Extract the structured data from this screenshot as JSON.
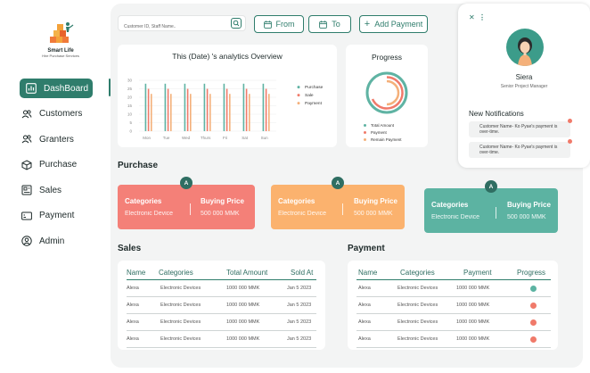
{
  "brand": {
    "name": "Smart Life",
    "tagline": "Hire Purchase Services"
  },
  "nav": [
    {
      "label": "DashBoard",
      "icon": "bar-chart-icon",
      "active": true
    },
    {
      "label": "Customers",
      "icon": "users-icon"
    },
    {
      "label": "Granters",
      "icon": "users-icon"
    },
    {
      "label": "Purchase",
      "icon": "box-icon"
    },
    {
      "label": "Sales",
      "icon": "sales-icon"
    },
    {
      "label": "Payment",
      "icon": "payment-icon"
    },
    {
      "label": "Admin",
      "icon": "user-circle-icon"
    }
  ],
  "toolbar": {
    "search_placeholder": "Customer ID, Staff Name..",
    "from_label": "From",
    "to_label": "To",
    "add_payment_label": "Add Payment"
  },
  "analytics": {
    "title": "This (Date) 's analytics Overview"
  },
  "chart_data": {
    "type": "bar",
    "categories": [
      "Mon",
      "Tue",
      "Wed",
      "Thurs",
      "Fri",
      "Sat",
      "Sun"
    ],
    "ylim": [
      0,
      30
    ],
    "yticks": [
      0,
      5,
      10,
      15,
      20,
      25,
      30
    ],
    "series": [
      {
        "name": "Purchase",
        "color": "#5fb3a3",
        "values": [
          28,
          28,
          28,
          28,
          28,
          28,
          28
        ]
      },
      {
        "name": "Sale",
        "color": "#f07a6a",
        "values": [
          25,
          25,
          25,
          25,
          25,
          25,
          25
        ]
      },
      {
        "name": "Payment",
        "color": "#f4b07a",
        "values": [
          22,
          22,
          22,
          22,
          22,
          22,
          22
        ]
      }
    ],
    "legend_position": "right",
    "grid": true
  },
  "progress": {
    "title": "Progress",
    "legend": [
      {
        "label": "Total Amount",
        "color": "#5fb3a3"
      },
      {
        "label": "Payment",
        "color": "#f07a6a"
      },
      {
        "label": "Remain Payment",
        "color": "#f4b07a"
      }
    ]
  },
  "purchase": {
    "title": "Purchase",
    "cards": [
      {
        "badge": "A",
        "category_label": "Categories",
        "category_value": "Electronic Device",
        "price_label": "Buying Price",
        "price_value": "500 000 MMK",
        "color": "#f48078"
      },
      {
        "badge": "A",
        "category_label": "Categories",
        "category_value": "Electronic Device",
        "price_label": "Buying Price",
        "price_value": "500 000 MMK",
        "color": "#fbb26e"
      },
      {
        "badge": "A",
        "category_label": "Categories",
        "category_value": "Electronic Device",
        "price_label": "Buying Price",
        "price_value": "500 000 MMK",
        "color": "#5cb3a2"
      }
    ]
  },
  "sales": {
    "title": "Sales",
    "columns": [
      "Name",
      "Categories",
      "Total Amount",
      "Sold At"
    ],
    "rows": [
      [
        "Alexa",
        "Electronic Devices",
        "1000 000 MMK",
        "Jan 5 2023"
      ],
      [
        "Alexa",
        "Electronic Devices",
        "1000 000 MMK",
        "Jan 5 2023"
      ],
      [
        "Alexa",
        "Electronic Devices",
        "1000 000 MMK",
        "Jan 5 2023"
      ],
      [
        "Alexa",
        "Electronic Devices",
        "1000 000 MMK",
        "Jan 5 2023"
      ]
    ]
  },
  "payment": {
    "title": "Payment",
    "columns": [
      "Name",
      "Categories",
      "Payment",
      "Progress"
    ],
    "rows": [
      [
        "Alexa",
        "Electronic Devices",
        "1000 000 MMK"
      ],
      [
        "Alexa",
        "Electronic Devices",
        "1000 000 MMK"
      ],
      [
        "Alexa",
        "Electronic Devices",
        "1000 000 MMK"
      ],
      [
        "Alexa",
        "Electronic Devices",
        "1000 000 MMK"
      ]
    ],
    "progress_colors": [
      "#5cb3a2",
      "#f07a6a",
      "#f07a6a",
      "#f07a6a"
    ]
  },
  "user": {
    "name": "Siera",
    "role": "Senior Project Manager"
  },
  "notifications": {
    "title": "New Notifications",
    "items": [
      "Customer Name- Ko Pyae's payment is over-time.",
      "Customer Name- Ko Pyae's payment is over-time."
    ]
  }
}
